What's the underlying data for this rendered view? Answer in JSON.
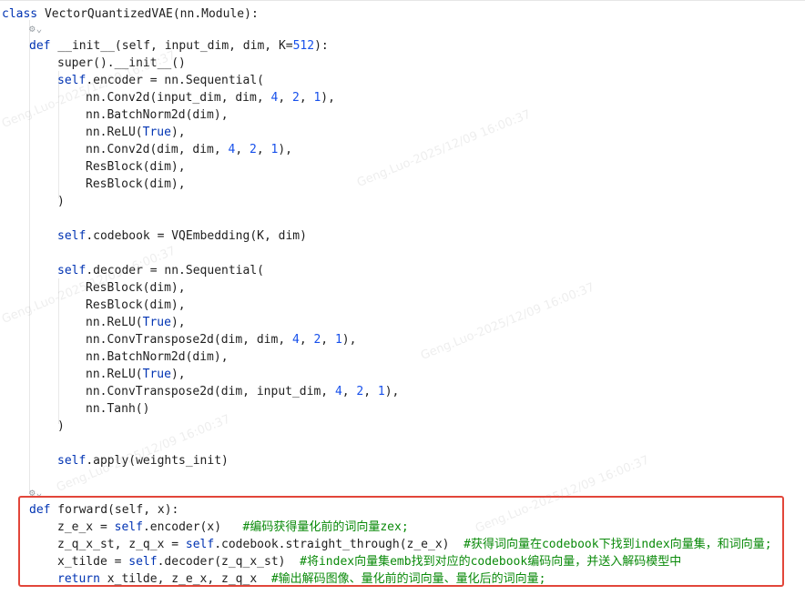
{
  "code": {
    "class_line": [
      "class ",
      "VectorQuantizedVAE(nn.Module):"
    ],
    "lines": [
      {
        "k": "def",
        "t": "def __init__(self, input_dim, dim, K=512):"
      },
      {
        "t": "super().__init__()"
      },
      {
        "t": "self.encoder = nn.Sequential("
      },
      {
        "t": "nn.Conv2d(input_dim, dim, 4, 2, 1),"
      },
      {
        "t": "nn.BatchNorm2d(dim),"
      },
      {
        "t": "nn.ReLU(True),"
      },
      {
        "t": "nn.Conv2d(dim, dim, 4, 2, 1),"
      },
      {
        "t": "ResBlock(dim),"
      },
      {
        "t": "ResBlock(dim),"
      },
      {
        "t": ")"
      },
      {
        "t": "self.codebook = VQEmbedding(K, dim)"
      },
      {
        "t": "self.decoder = nn.Sequential("
      },
      {
        "t": "ResBlock(dim),"
      },
      {
        "t": "ResBlock(dim),"
      },
      {
        "t": "nn.ReLU(True),"
      },
      {
        "t": "nn.ConvTranspose2d(dim, dim, 4, 2, 1),"
      },
      {
        "t": "nn.BatchNorm2d(dim),"
      },
      {
        "t": "nn.ReLU(True),"
      },
      {
        "t": "nn.ConvTranspose2d(dim, input_dim, 4, 2, 1),"
      },
      {
        "t": "nn.Tanh()"
      },
      {
        "t": ")"
      },
      {
        "t": "self.apply(weights_init)"
      },
      {
        "t": "def forward(self, x):"
      },
      {
        "t": "z_e_x = self.encoder(x)"
      },
      {
        "t": "z_q_x_st, z_q_x = self.codebook.straight_through(z_e_x)"
      },
      {
        "t": "x_tilde = self.decoder(z_q_x_st)"
      },
      {
        "t": "return x_tilde, z_e_x, z_q_x"
      }
    ],
    "comments": {
      "encode": "#编码获得量化前的词向量zex;",
      "straight": "#获得词向量在codebook下找到index向量集，和词向量;",
      "decode": "#将index向量集emb找到对应的codebook编码向量，并送入解码模型中",
      "ret": "#输出解码图像、量化前的词向量、量化后的词向量;"
    }
  },
  "watermark": "Geng.Luo-2025/12/09  16:00:37",
  "colors": {
    "keyword": "#0033b3",
    "number": "#1750eb",
    "comment": "#0a8a0a",
    "highlight_border": "#e2463a"
  }
}
